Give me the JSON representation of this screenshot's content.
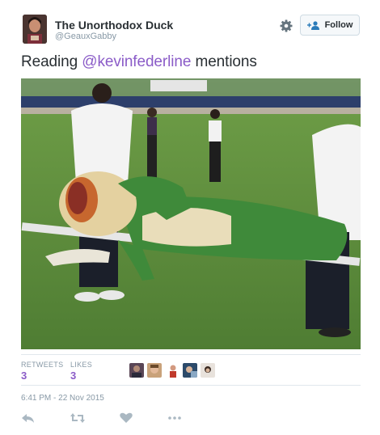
{
  "user": {
    "name": "The Unorthodox Duck",
    "handle": "@GeauxGabby"
  },
  "follow_label": "Follow",
  "tweet": {
    "text_before": "Reading ",
    "mention": "@kevinfederline",
    "text_after": " mentions"
  },
  "stats": {
    "retweets_label": "RETWEETS",
    "retweets_value": "3",
    "likes_label": "LIKES",
    "likes_value": "3"
  },
  "timestamp": "6:41 PM - 22 Nov 2015",
  "icons": {
    "settings": "gear-icon",
    "follow": "add-user-icon",
    "reply": "reply-icon",
    "retweet": "retweet-icon",
    "like": "heart-icon",
    "more": "more-icon"
  },
  "colors": {
    "link": "#8b5cc8",
    "muted": "#8899a6",
    "text": "#292f33"
  }
}
